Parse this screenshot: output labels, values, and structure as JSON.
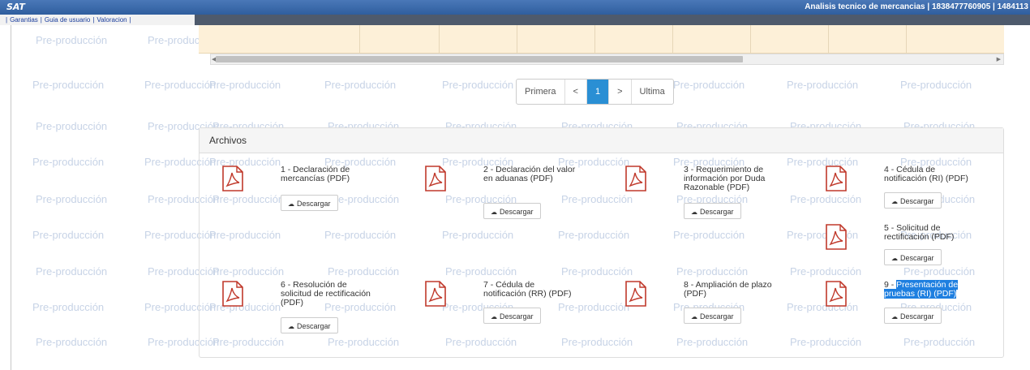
{
  "header": {
    "logo": "SAT",
    "title": "Analisis tecnico de mercancias | 1838477760905 | 1484113"
  },
  "menu": [
    "Garantias",
    "Guia de usuario",
    "Valoracion"
  ],
  "watermark": "Pre-producción",
  "pagination": [
    "Primera",
    "<",
    "1",
    ">",
    "Ultima"
  ],
  "panel": {
    "title": "Archivos",
    "download_label": "Descargar",
    "files": [
      {
        "title": "1 - Declaración de mercancías (PDF)"
      },
      {
        "title": "2 - Declaración del valor en aduanas (PDF)"
      },
      {
        "title": "3 - Requerimiento de información por Duda Razonable (PDF)"
      },
      {
        "title": "4 - Cédula de notificación (RI) (PDF)"
      },
      {
        "title": "5 - Solicitud de rectificación (PDF)"
      },
      {
        "title": "6 - Resolución de solicitud de rectificación (PDF)"
      },
      {
        "title": "7 - Cédula de notificación (RR) (PDF)"
      },
      {
        "title": "8 - Ampliación de plazo (PDF)"
      },
      {
        "title_prefix": "9 - ",
        "title_highlight": "Presentación de pruebas (RI) (PDF)"
      }
    ]
  },
  "colors": {
    "accent": "#2a8fd4",
    "header": "#2f5e9e",
    "pdf": "#c0392b"
  }
}
